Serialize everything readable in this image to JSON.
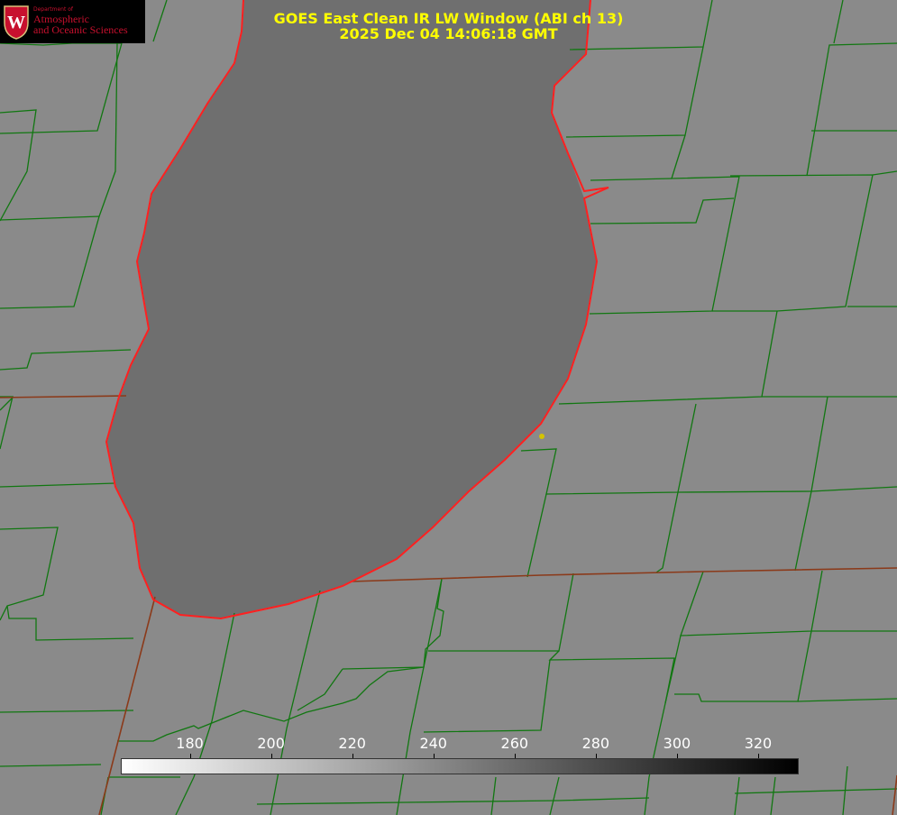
{
  "title": {
    "line1": "GOES East Clean IR LW Window (ABI ch 13)",
    "line2": "2025 Dec 04 14:06:18 GMT"
  },
  "logo": {
    "department": "Department of",
    "line1": "Atmospheric",
    "line2": "and Oceanic Sciences",
    "seal_letter": "W"
  },
  "colorbar": {
    "ticks": [
      "180",
      "200",
      "220",
      "240",
      "260",
      "280",
      "300",
      "320"
    ],
    "range": [
      163,
      330
    ],
    "gradient": [
      "#ffffff",
      "#000000"
    ]
  },
  "colors": {
    "land": "#8a8a8a",
    "lake": "#6e6e6e",
    "county_lines": "#117711",
    "state_lines": "#8b3a1a",
    "coastline": "#ff2020",
    "title": "#ffff00",
    "marker": "#d4c400"
  }
}
